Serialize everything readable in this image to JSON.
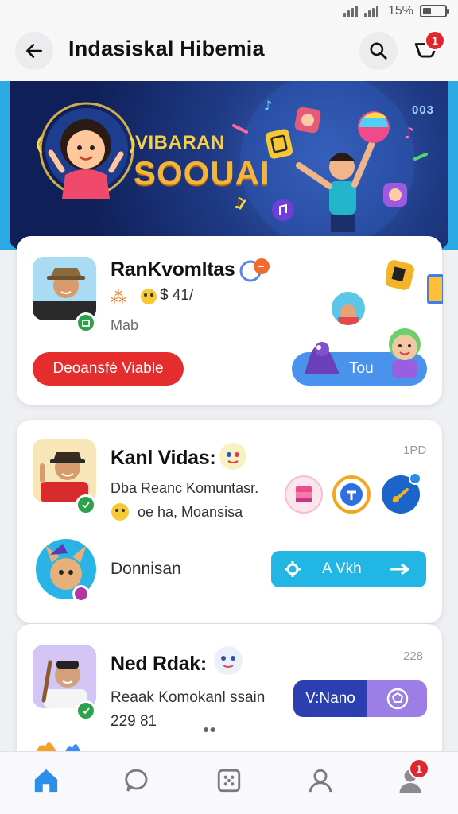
{
  "status_bar": {
    "battery": "15%"
  },
  "header": {
    "title": "Indasiskal Hibemia",
    "cart_badge": "1"
  },
  "banner": {
    "title_line1": "VIBARAN",
    "title_line2": "SOOUAI",
    "counter": "003"
  },
  "cards": [
    {
      "name": "RanKvomltas",
      "meta": "$ 41/",
      "sub": "Mab",
      "primary_button": "Deoansfé Viable",
      "secondary_button": "Tou"
    },
    {
      "name": "Kanl Vidas:",
      "time": "1PD",
      "desc_line1": "Dba Reanc Komuntasr.",
      "desc_line2": "oe ha, Moansisa",
      "row_label": "Donnisan",
      "action_button": "A Vkh"
    },
    {
      "name": "Ned Rdak:",
      "time": "228",
      "desc_line1": "Reaak Komokanl ssain",
      "desc_line2": "229 81",
      "primary_button": "V:Nano"
    }
  ],
  "bottom_nav": {
    "items": [
      "home",
      "chat",
      "apps",
      "profile",
      "account"
    ],
    "account_badge": "1"
  },
  "colors": {
    "accent": "#2b8fe6",
    "badge": "#e0262f",
    "red_button": "#e52d2d",
    "cyan_button": "#22b6e4",
    "navy_button": "#2c3fb1"
  }
}
